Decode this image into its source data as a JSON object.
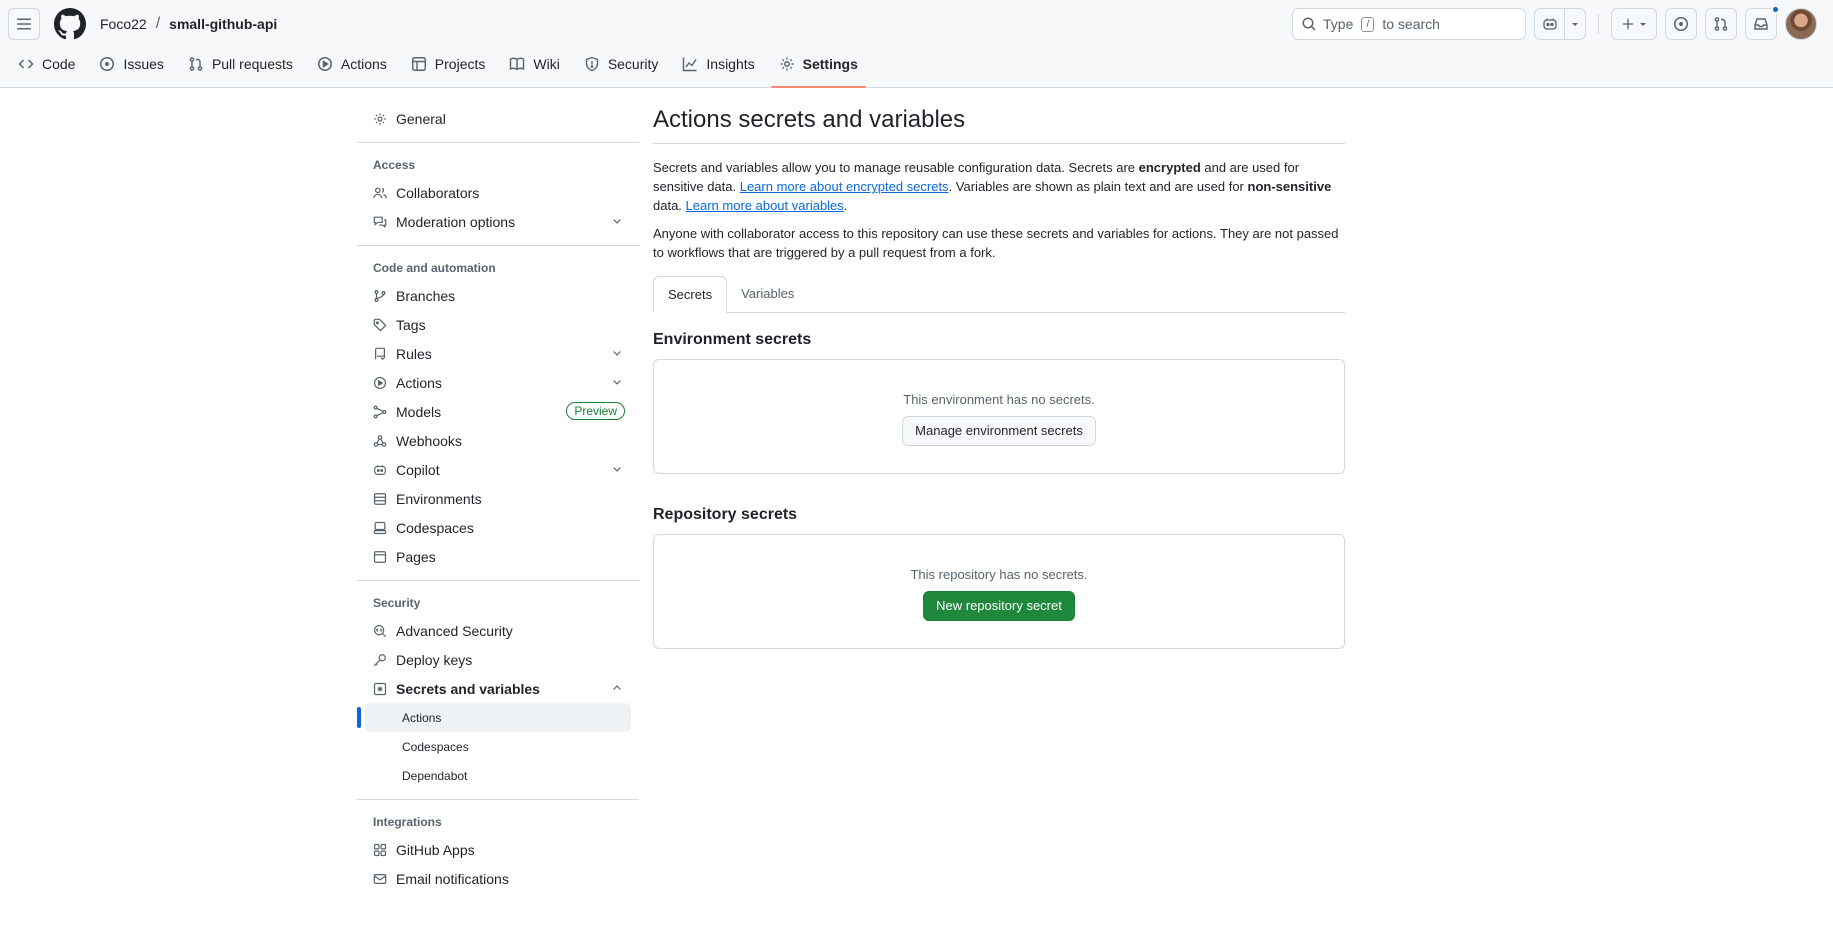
{
  "header": {
    "owner": "Foco22",
    "separator": "/",
    "repo": "small-github-api",
    "search_prefix": "Type",
    "search_key": "/",
    "search_suffix": "to search"
  },
  "repo_tabs": [
    {
      "label": "Code",
      "icon": "code-icon"
    },
    {
      "label": "Issues",
      "icon": "issue-opened-icon"
    },
    {
      "label": "Pull requests",
      "icon": "git-pull-request-icon"
    },
    {
      "label": "Actions",
      "icon": "play-icon"
    },
    {
      "label": "Projects",
      "icon": "table-icon"
    },
    {
      "label": "Wiki",
      "icon": "book-icon"
    },
    {
      "label": "Security",
      "icon": "shield-icon"
    },
    {
      "label": "Insights",
      "icon": "graph-icon"
    },
    {
      "label": "Settings",
      "icon": "gear-icon",
      "selected": true
    }
  ],
  "sidebar": {
    "general": "General",
    "access_title": "Access",
    "collaborators": "Collaborators",
    "moderation": "Moderation options",
    "code_title": "Code and automation",
    "branches": "Branches",
    "tags": "Tags",
    "rules": "Rules",
    "actions": "Actions",
    "models": "Models",
    "models_badge": "Preview",
    "webhooks": "Webhooks",
    "copilot": "Copilot",
    "environments": "Environments",
    "codespaces": "Codespaces",
    "pages": "Pages",
    "security_title": "Security",
    "advanced_security": "Advanced Security",
    "deploy_keys": "Deploy keys",
    "secrets_vars": "Secrets and variables",
    "sub_actions": "Actions",
    "sub_codespaces": "Codespaces",
    "sub_dependabot": "Dependabot",
    "integrations_title": "Integrations",
    "github_apps": "GitHub Apps",
    "email_notifications": "Email notifications"
  },
  "main": {
    "title": "Actions secrets and variables",
    "desc1_a": "Secrets and variables allow you to manage reusable configuration data. Secrets are ",
    "desc1_b": "encrypted",
    "desc1_c": " and are used for sensitive data. ",
    "desc1_link1": "Learn more about encrypted secrets",
    "desc1_d": ". Variables are shown as plain text and are used for ",
    "desc1_e": "non-sensitive",
    "desc1_f": " data. ",
    "desc1_link2": "Learn more about variables",
    "desc1_g": ".",
    "desc2": "Anyone with collaborator access to this repository can use these secrets and variables for actions. They are not passed to workflows that are triggered by a pull request from a fork.",
    "tab_secrets": "Secrets",
    "tab_variables": "Variables",
    "env_title": "Environment secrets",
    "env_empty": "This environment has no secrets.",
    "env_button": "Manage environment secrets",
    "repo_title": "Repository secrets",
    "repo_empty": "This repository has no secrets.",
    "repo_button": "New repository secret"
  }
}
